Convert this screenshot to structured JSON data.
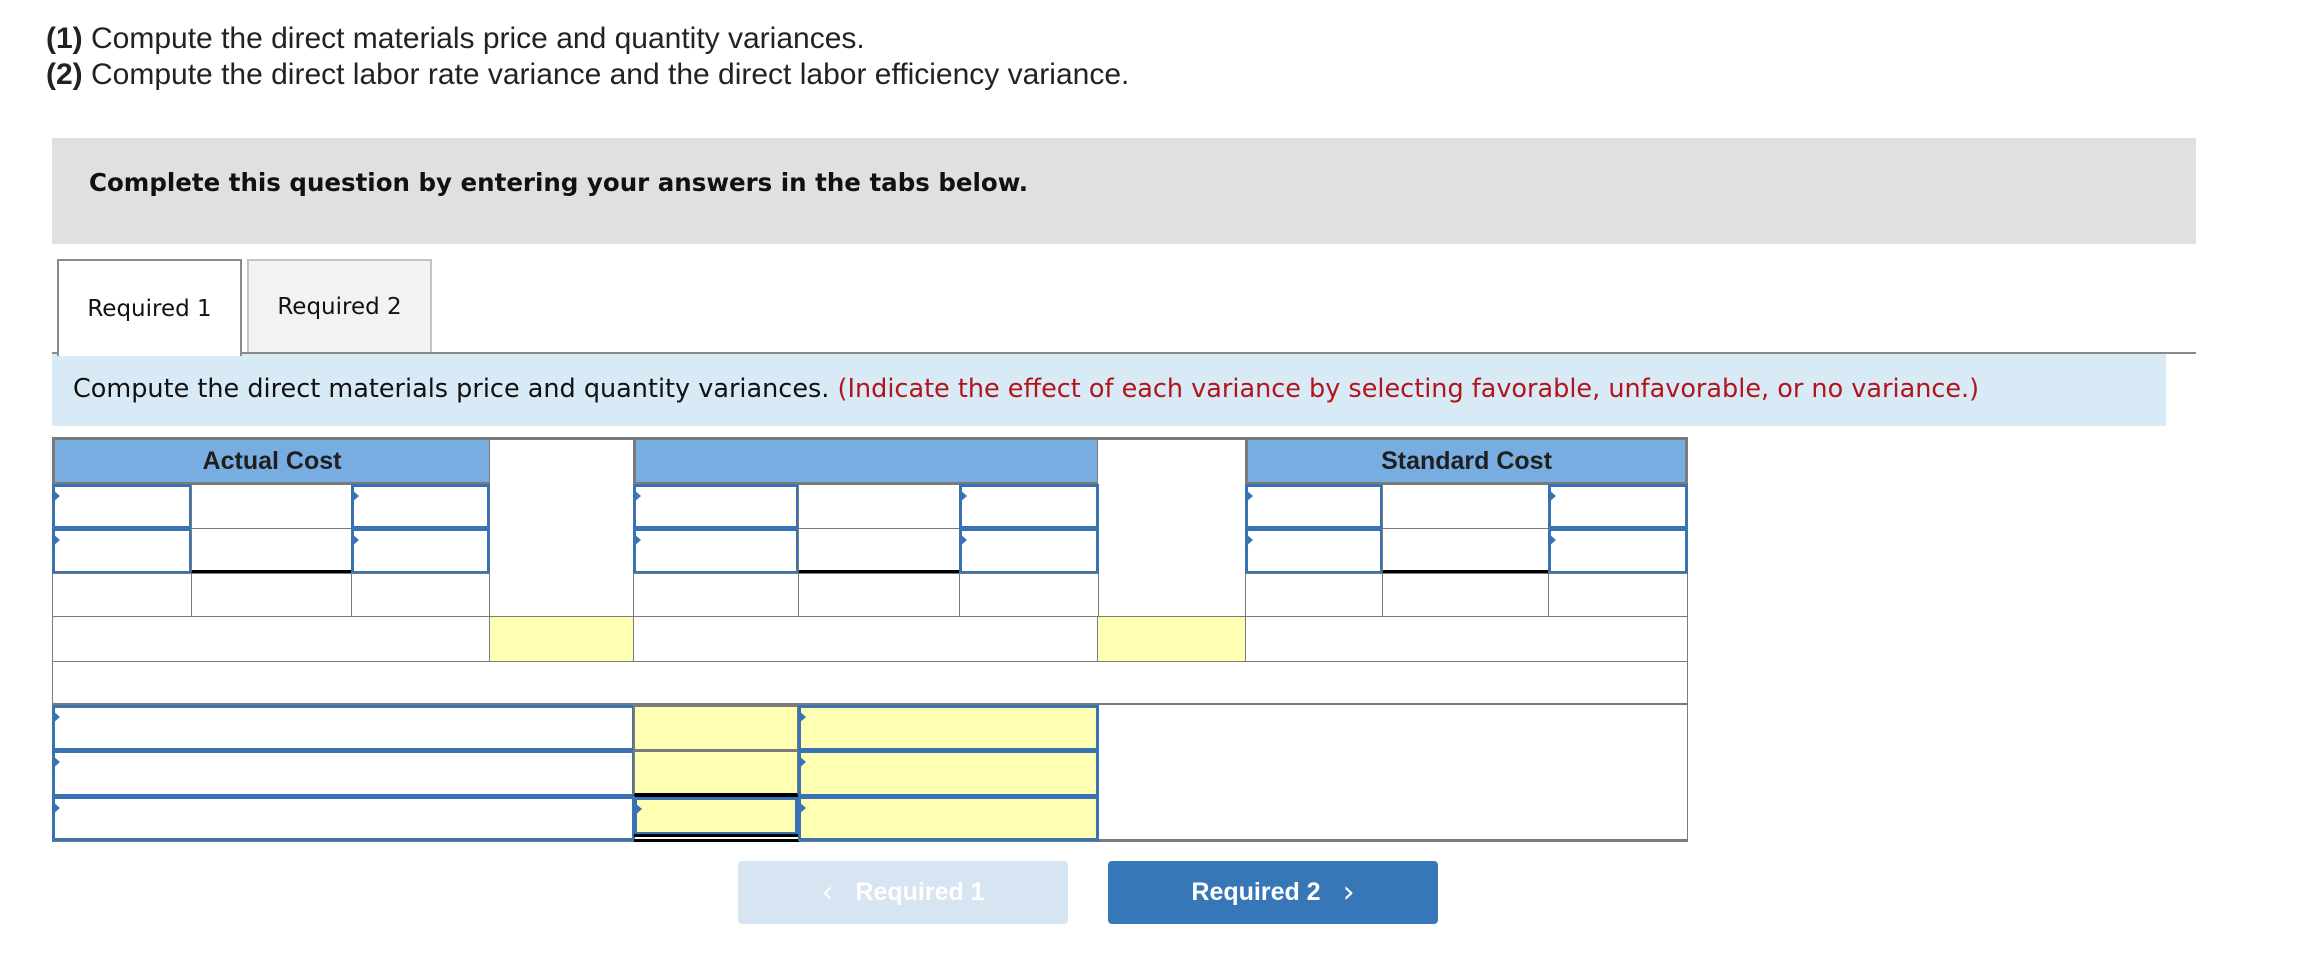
{
  "question": {
    "parts": [
      {
        "label": "(1)",
        "text": " Compute the direct materials price and quantity variances."
      },
      {
        "label": "(2)",
        "text": " Compute the direct labor rate variance and the direct labor efficiency variance."
      }
    ]
  },
  "instructions_banner": "Complete this question by entering your answers in the tabs below.",
  "tabs": [
    {
      "label": "Required 1",
      "active": true
    },
    {
      "label": "Required 2",
      "active": false
    }
  ],
  "prompt": {
    "text": "Compute the direct materials price and quantity variances. ",
    "note": "(Indicate the effect of each variance by selecting favorable, unfavorable, or no variance.)",
    "note_color": "#b3141a"
  },
  "table": {
    "headers": {
      "actual_cost": "Actual Cost",
      "middle": "",
      "standard_cost": "Standard Cost"
    },
    "inputs": {
      "actual_row1_label": "",
      "actual_row1_value": "",
      "actual_row1_unit": "",
      "actual_row2_label": "",
      "actual_row2_value": "",
      "actual_row2_unit": "",
      "middle_row1_label": "",
      "middle_row1_value": "",
      "middle_row1_unit": "",
      "middle_row2_label": "",
      "middle_row2_value": "",
      "middle_row2_unit": "",
      "standard_row1_label": "",
      "standard_row1_value": "",
      "standard_row1_unit": "",
      "standard_row2_label": "",
      "standard_row2_value": "",
      "standard_row2_unit": "",
      "total_actual": "",
      "total_middle": "",
      "variances": [
        {
          "name": "",
          "amount": "",
          "effect": ""
        },
        {
          "name": "",
          "amount": "",
          "effect": ""
        },
        {
          "name": "",
          "amount": "",
          "effect": ""
        }
      ]
    }
  },
  "navigation": {
    "prev_label": "Required 1",
    "next_label": "Required 2",
    "prev_enabled": false,
    "next_enabled": true
  },
  "colors": {
    "header_blue": "#78ade2",
    "input_border": "#3a73b3",
    "answer_yellow": "#ffffb3",
    "nav_active": "#3777b7",
    "nav_disabled": "#d7e4f1",
    "prompt_band": "#d9eaf7",
    "banner_gray": "#e0e0e0"
  }
}
